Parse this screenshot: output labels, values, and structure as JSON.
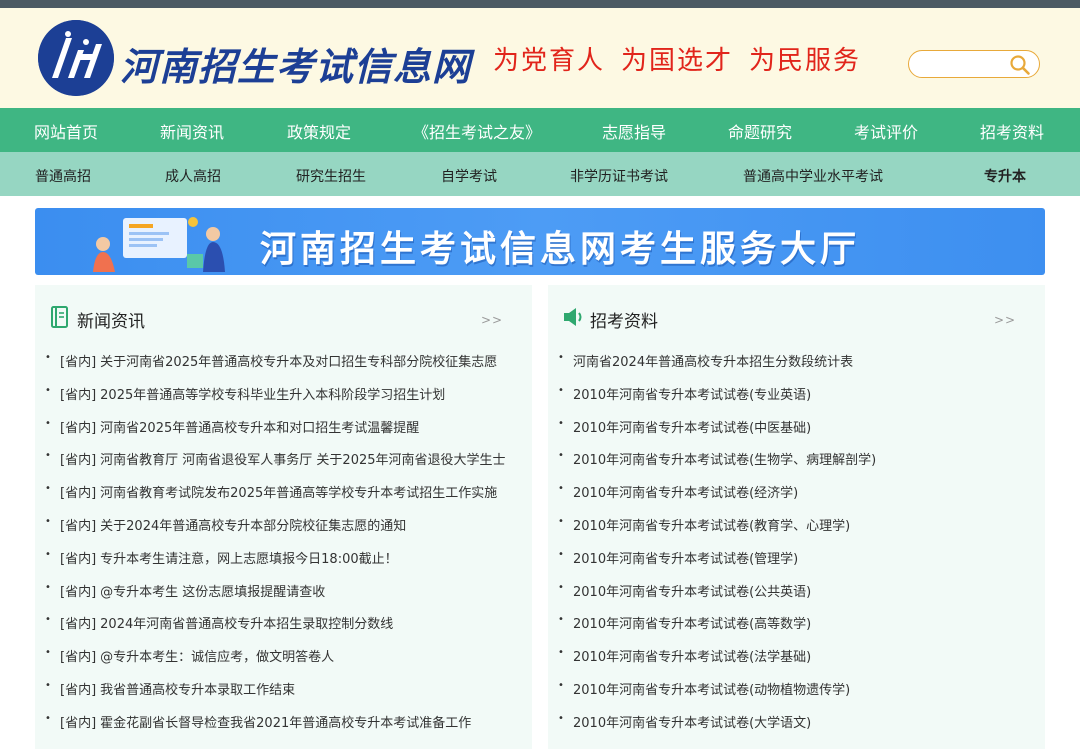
{
  "header": {
    "site_name": "河南招生考试信息网",
    "slogans": [
      "为党育人",
      "为国选才",
      "为民服务"
    ],
    "search": {
      "placeholder": "",
      "value": ""
    }
  },
  "nav_main": [
    "网站首页",
    "新闻资讯",
    "政策规定",
    "《招生考试之友》",
    "志愿指导",
    "命题研究",
    "考试评价",
    "招考资料"
  ],
  "nav_sub": [
    "普通高招",
    "成人高招",
    "研究生招生",
    "自学考试",
    "非学历证书考试",
    "普通高中学业水平考试",
    "专升本"
  ],
  "banner": {
    "text": "河南招生考试信息网考生服务大厅"
  },
  "news": {
    "title": "新闻资讯",
    "more": ">>",
    "items": [
      {
        "tag": "[省内]",
        "text": "关于河南省2025年普通高校专升本及对口招生专科部分院校征集志愿"
      },
      {
        "tag": "[省内]",
        "text": "2025年普通高等学校专科毕业生升入本科阶段学习招生计划"
      },
      {
        "tag": "[省内]",
        "text": "河南省2025年普通高校专升本和对口招生考试温馨提醒"
      },
      {
        "tag": "[省内]",
        "text": "河南省教育厅 河南省退役军人事务厅 关于2025年河南省退役大学生士"
      },
      {
        "tag": "[省内]",
        "text": "河南省教育考试院发布2025年普通高等学校专升本考试招生工作实施"
      },
      {
        "tag": "[省内]",
        "text": "关于2024年普通高校专升本部分院校征集志愿的通知"
      },
      {
        "tag": "[省内]",
        "text": "专升本考生请注意，网上志愿填报今日18:00截止！"
      },
      {
        "tag": "[省内]",
        "text": "@专升本考生 这份志愿填报提醒请查收"
      },
      {
        "tag": "[省内]",
        "text": "2024年河南省普通高校专升本招生录取控制分数线"
      },
      {
        "tag": "[省内]",
        "text": "@专升本考生：诚信应考，做文明答卷人"
      },
      {
        "tag": "[省内]",
        "text": "我省普通高校专升本录取工作结束"
      },
      {
        "tag": "[省内]",
        "text": "霍金花副省长督导检查我省2021年普通高校专升本考试准备工作"
      }
    ]
  },
  "materials": {
    "title": "招考资料",
    "more": ">>",
    "items": [
      "河南省2024年普通高校专升本招生分数段统计表",
      "2010年河南省专升本考试试卷(专业英语)",
      "2010年河南省专升本考试试卷(中医基础)",
      "2010年河南省专升本考试试卷(生物学、病理解剖学)",
      "2010年河南省专升本考试试卷(经济学)",
      "2010年河南省专升本考试试卷(教育学、心理学)",
      "2010年河南省专升本考试试卷(管理学)",
      "2010年河南省专升本考试试卷(公共英语)",
      "2010年河南省专升本考试试卷(高等数学)",
      "2010年河南省专升本考试试卷(法学基础)",
      "2010年河南省专升本考试试卷(动物植物遗传学)",
      "2010年河南省专升本考试试卷(大学语文)"
    ]
  },
  "colors": {
    "nav_main_bg": "#3fb683",
    "nav_sub_bg": "#96d6c2",
    "header_bg": "#fdf9e3",
    "brand_blue": "#1c3f95",
    "slogan_red": "#e1251b",
    "panel_bg": "#f2faf7"
  }
}
